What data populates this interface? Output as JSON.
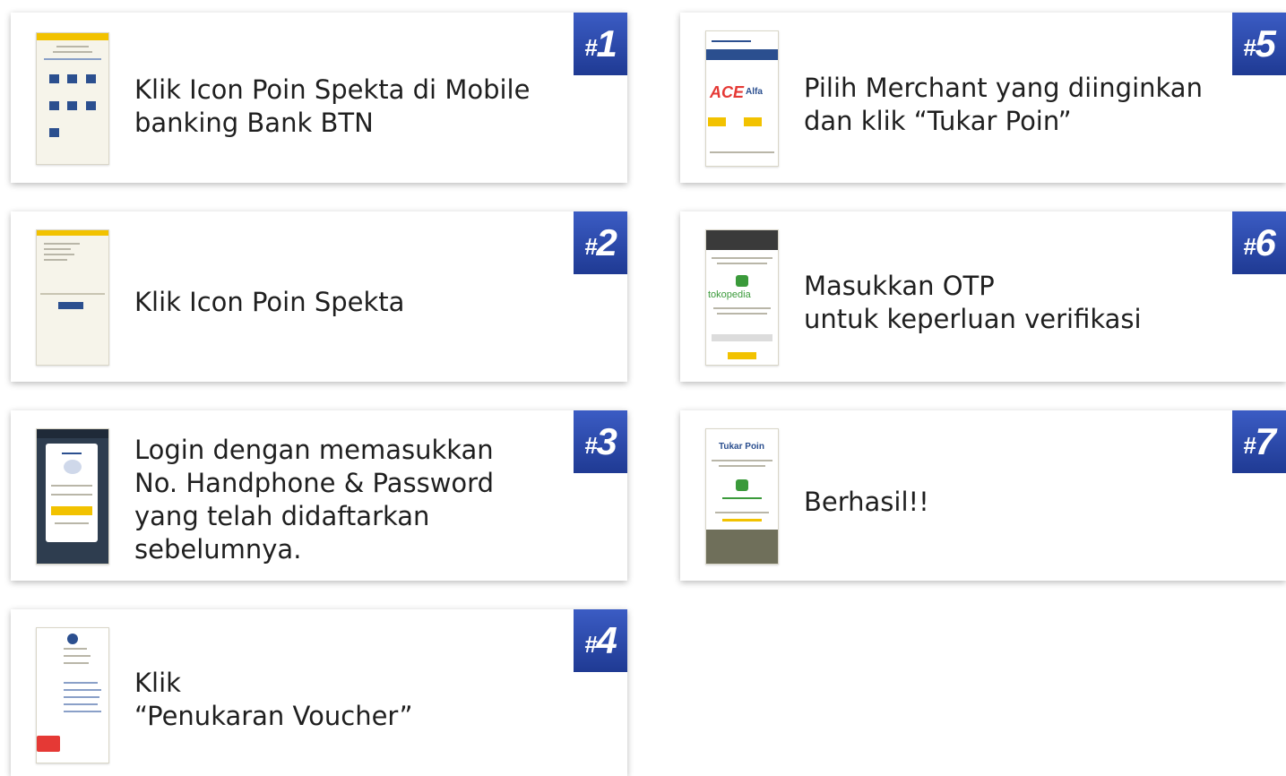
{
  "steps": [
    {
      "hash": "#",
      "num": "1",
      "caption": "Klik Icon Poin Spekta di Mobile\nbanking Bank BTN",
      "thumb_icon": "mobile-banking-home-screenshot"
    },
    {
      "hash": "#",
      "num": "2",
      "caption": "Klik Icon Poin Spekta",
      "thumb_icon": "poin-spekta-screenshot"
    },
    {
      "hash": "#",
      "num": "3",
      "caption": "Login dengan memasukkan\nNo. Handphone & Password\nyang telah didaftarkan\nsebelumnya.",
      "thumb_icon": "login-screenshot"
    },
    {
      "hash": "#",
      "num": "4",
      "caption": "Klik\n“Penukaran Voucher”",
      "thumb_icon": "menu-screenshot"
    },
    {
      "hash": "#",
      "num": "5",
      "caption": "Pilih Merchant yang diinginkan\ndan klik “Tukar Poin”",
      "thumb_icon": "merchant-list-screenshot",
      "thumb_text": {
        "brand1": "ACE",
        "brand2": "Alfa"
      }
    },
    {
      "hash": "#",
      "num": "6",
      "caption": "Masukkan OTP\nuntuk keperluan verifikasi",
      "thumb_icon": "otp-screenshot",
      "thumb_text": {
        "brand": "tokopedia"
      }
    },
    {
      "hash": "#",
      "num": "7",
      "caption": "Berhasil!!",
      "thumb_icon": "success-screenshot",
      "thumb_text": {
        "title": "Tukar Poin"
      }
    }
  ],
  "colors": {
    "badge": "#2b4bb0",
    "text": "#1f1f1f",
    "card": "#ffffff"
  }
}
